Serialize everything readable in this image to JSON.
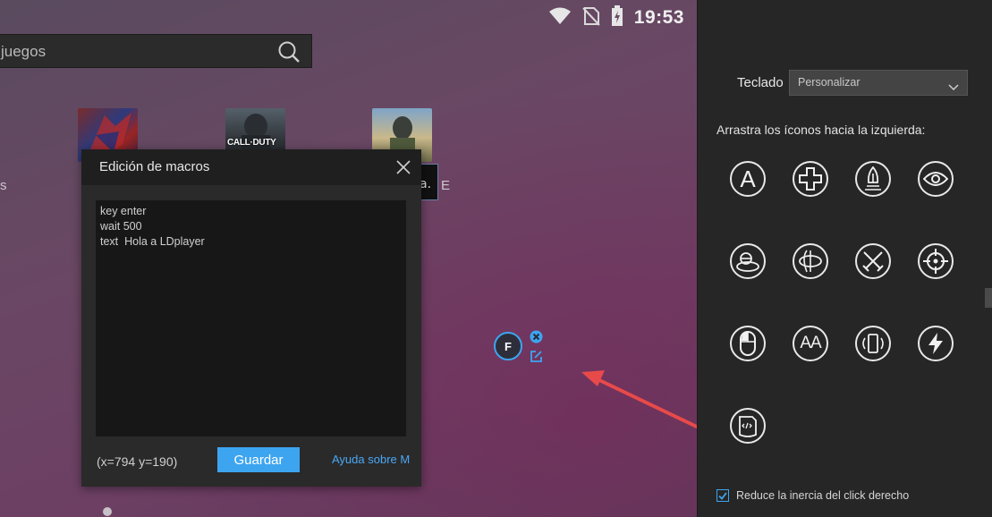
{
  "status_bar": {
    "time": "19:53",
    "icons": [
      "wifi-icon",
      "no-sim-icon",
      "battery-icon"
    ]
  },
  "search": {
    "placeholder": "juegos",
    "icon": "search-icon"
  },
  "desktop": {
    "left_stub": "s",
    "right_stub": "E",
    "tooltip_text": "a."
  },
  "apps": [
    {
      "name": "spiderman-app",
      "caption": ""
    },
    {
      "name": "call-of-duty-app",
      "caption": "CALL·DUTY"
    },
    {
      "name": "pubg-app",
      "caption": ""
    }
  ],
  "macro_dialog": {
    "title": "Edición de macros",
    "script": "key enter\nwait 500\ntext  Hola a LDplayer",
    "coords": "(x=794  y=190)",
    "save_label": "Guardar",
    "help_label": "Ayuda sobre M"
  },
  "key_marker": {
    "label": "F"
  },
  "panel": {
    "keyboard_label": "Teclado",
    "keyboard_value": "Personalizar",
    "drag_hint": "Arrastra los íconos hacia la izquierda:",
    "tools": [
      {
        "icon": "text-key-icon",
        "glyph": "A"
      },
      {
        "icon": "dpad-icon"
      },
      {
        "icon": "fire-icon"
      },
      {
        "icon": "eye-icon"
      },
      {
        "icon": "aim-view-icon"
      },
      {
        "icon": "rotate-view-icon"
      },
      {
        "icon": "crossed-swords-icon"
      },
      {
        "icon": "crosshair-icon"
      },
      {
        "icon": "mouse-icon"
      },
      {
        "icon": "double-key-icon",
        "glyph": "AA"
      },
      {
        "icon": "shake-icon"
      },
      {
        "icon": "lightning-icon"
      },
      {
        "icon": "macro-script-icon"
      }
    ],
    "reduce_inertia_label": "Reduce la inercia del click derecho",
    "reduce_inertia_checked": true
  },
  "colors": {
    "accent": "#3da5f0",
    "panel_bg": "#262626",
    "dialog_bg": "#2a2a2a",
    "arrow": "#e84a4a"
  }
}
